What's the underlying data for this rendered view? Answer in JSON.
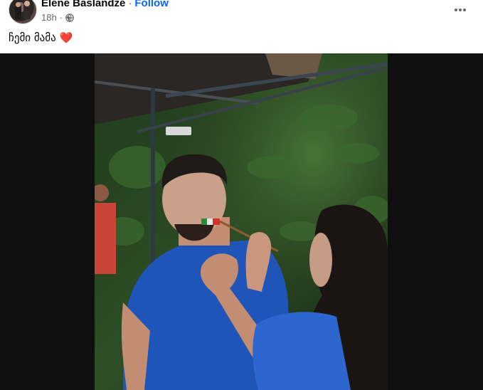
{
  "post": {
    "author": "Elene Baslandze",
    "separator": "·",
    "follow_label": "Follow",
    "time": "18h",
    "time_separator": "·",
    "audience_icon": "globe-icon",
    "more_icon": "more-horizontal-icon",
    "caption_text": "ჩემი მამა",
    "caption_emoji": "❤️"
  },
  "colors": {
    "link": "#0866ff",
    "heart": "#e41e3f",
    "meta": "#65676b"
  }
}
